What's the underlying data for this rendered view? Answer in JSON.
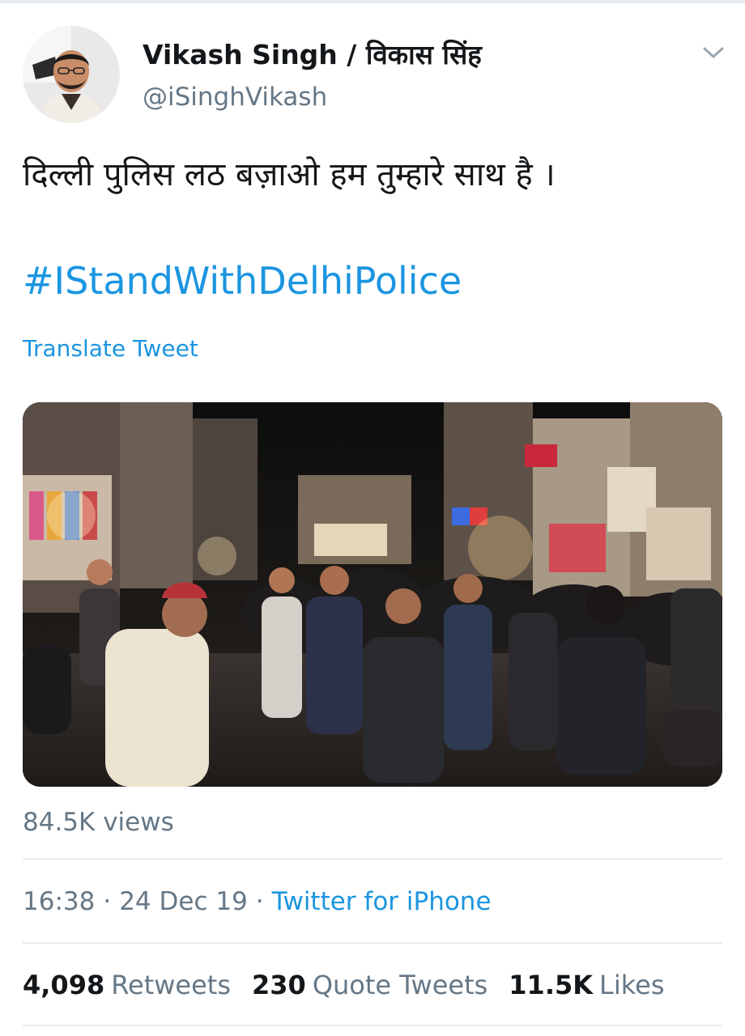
{
  "tweet": {
    "author": {
      "display_name": "Vikash Singh / विकास सिंह",
      "handle": "@iSinghVikash"
    },
    "text": "दिल्ली पुलिस लठ बज़ाओ हम तुम्हारे साथ है ।",
    "hashtag": "#IStandWithDelhiPolice",
    "translate_label": "Translate Tweet",
    "media": {
      "kind": "video"
    },
    "views": "84.5K views",
    "time": "16:38",
    "date": "24 Dec 19",
    "separator": "·",
    "source": "Twitter for iPhone",
    "stats": {
      "retweets": {
        "count": "4,098",
        "label": "Retweets"
      },
      "quote_tweets": {
        "count": "230",
        "label": "Quote Tweets"
      },
      "likes": {
        "count": "11.5K",
        "label": "Likes"
      }
    }
  },
  "icons": {
    "menu": "chevron-down-icon"
  },
  "colors": {
    "link": "#1b95e0",
    "muted": "#657786",
    "text": "#14171a",
    "divider": "#e6ecf0"
  }
}
